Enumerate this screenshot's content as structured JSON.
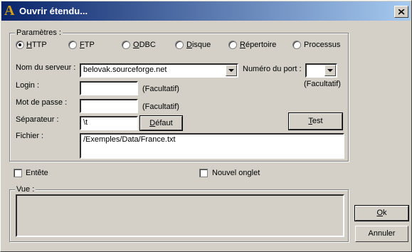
{
  "window": {
    "title": "Ouvrir étendu...",
    "app_icon_letter": "A"
  },
  "parametres": {
    "label": "Paramètres :",
    "protocols": [
      {
        "first": "H",
        "rest": "TTP",
        "selected": true
      },
      {
        "first": "F",
        "rest": "TP",
        "selected": false
      },
      {
        "first": "O",
        "rest": "DBC",
        "selected": false
      },
      {
        "first": "D",
        "rest": "isque",
        "selected": false
      },
      {
        "first": "R",
        "rest": "épertoire",
        "selected": false
      },
      {
        "first": "",
        "rest": "Processus",
        "selected": false
      }
    ],
    "server_label": "Nom du serveur :",
    "server_value": "belovak.sourceforge.net",
    "port_label": "Numéro du port :",
    "port_value": "",
    "port_hint": "(Facultatif)",
    "login_label": "Login :",
    "login_value": "",
    "login_hint": "(Facultatif)",
    "password_label": "Mot de passe :",
    "password_value": "",
    "password_hint": "(Facultatif)",
    "separator_label": "Séparateur :",
    "separator_value": "\\t",
    "default_button": {
      "first": "D",
      "rest": "éfaut"
    },
    "test_button": {
      "first": "T",
      "rest": "est"
    },
    "file_label": "Fichier :",
    "file_value": "/Exemples/Data/France.txt"
  },
  "options": {
    "header_label": "Entête",
    "header_checked": false,
    "new_tab_label": "Nouvel onglet",
    "new_tab_checked": false
  },
  "vue": {
    "label": "Vue :"
  },
  "buttons": {
    "ok": {
      "first": "O",
      "rest": "k"
    },
    "cancel": {
      "first": "",
      "rest": "Annuler"
    }
  }
}
